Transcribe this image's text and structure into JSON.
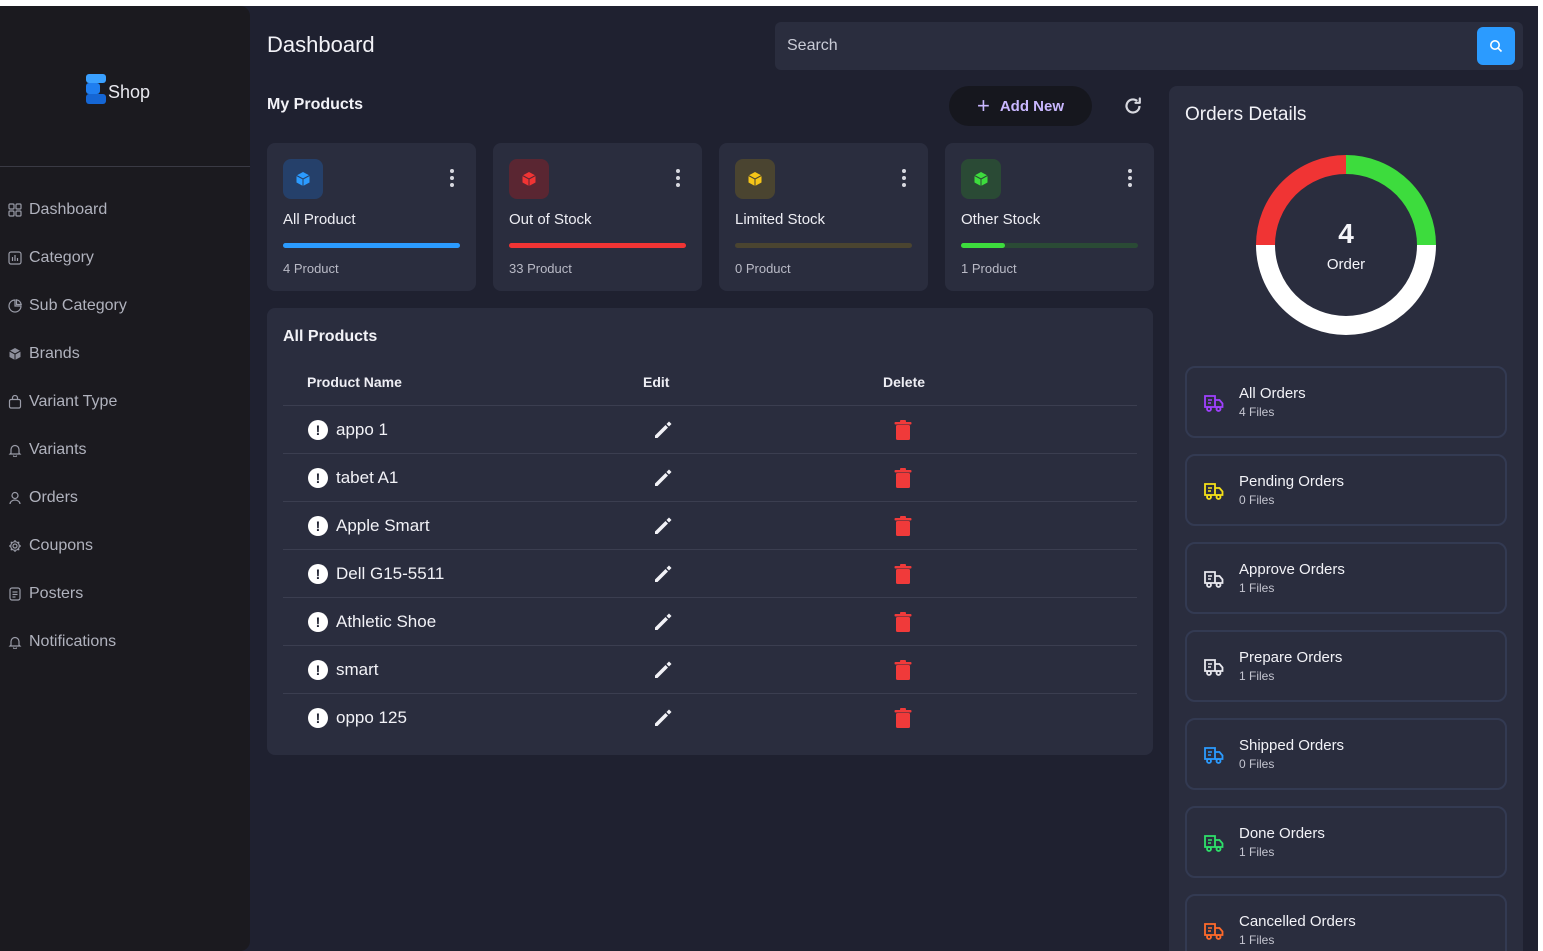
{
  "brand": {
    "name": "Shop"
  },
  "sidebar": {
    "items": [
      {
        "label": "Dashboard",
        "icon": "grid-icon"
      },
      {
        "label": "Category",
        "icon": "chart-icon"
      },
      {
        "label": "Sub Category",
        "icon": "pie-icon"
      },
      {
        "label": "Brands",
        "icon": "cube-icon"
      },
      {
        "label": "Variant Type",
        "icon": "bag-icon"
      },
      {
        "label": "Variants",
        "icon": "bell-icon"
      },
      {
        "label": "Orders",
        "icon": "user-icon"
      },
      {
        "label": "Coupons",
        "icon": "gear-icon"
      },
      {
        "label": "Posters",
        "icon": "document-icon"
      },
      {
        "label": "Notifications",
        "icon": "bell-icon"
      }
    ]
  },
  "header": {
    "title": "Dashboard",
    "search_placeholder": "Search"
  },
  "my_products": {
    "title": "My Products",
    "add_new_label": "Add New",
    "cards": [
      {
        "title": "All Product",
        "subtitle": "4 Product",
        "color": "#2b9bff",
        "icon_bg": "#25406a",
        "track": "#25406a",
        "progress": 1.0
      },
      {
        "title": "Out of Stock",
        "subtitle": "33 Product",
        "color": "#f03434",
        "icon_bg": "#5a2632",
        "track": "#5a2632",
        "progress": 1.0
      },
      {
        "title": "Limited Stock",
        "subtitle": "0 Product",
        "color": "#f5c518",
        "icon_bg": "#4a4430",
        "track": "#4a4430",
        "progress": 0.0
      },
      {
        "title": "Other Stock",
        "subtitle": "1 Product",
        "color": "#3ddc3d",
        "icon_bg": "#2a4a35",
        "track": "#2a4a35",
        "progress": 0.25
      }
    ]
  },
  "all_products": {
    "title": "All Products",
    "columns": [
      "Product Name",
      "Edit",
      "Delete"
    ],
    "rows": [
      {
        "name": "appo 1"
      },
      {
        "name": "tabet A1"
      },
      {
        "name": "Apple Smart"
      },
      {
        "name": "Dell G15-5511"
      },
      {
        "name": "Athletic Shoe"
      },
      {
        "name": "smart"
      },
      {
        "name": "oppo 125"
      }
    ]
  },
  "orders": {
    "title": "Orders Details",
    "total": "4",
    "total_label": "Order",
    "donut": [
      {
        "label": "white",
        "color": "#ffffff",
        "value": 0.5
      },
      {
        "label": "red",
        "color": "#f03434",
        "value": 0.25
      },
      {
        "label": "green",
        "color": "#3ddc3d",
        "value": 0.25
      }
    ],
    "items": [
      {
        "label": "All Orders",
        "sub": "4 Files",
        "color": "#a040ff"
      },
      {
        "label": "Pending Orders",
        "sub": "0 Files",
        "color": "#f5e018"
      },
      {
        "label": "Approve Orders",
        "sub": "1 Files",
        "color": "#e8e8ee"
      },
      {
        "label": "Prepare Orders",
        "sub": "1 Files",
        "color": "#e8e8ee"
      },
      {
        "label": "Shipped Orders",
        "sub": "0 Files",
        "color": "#2b9bff"
      },
      {
        "label": "Done Orders",
        "sub": "1 Files",
        "color": "#2ee06a"
      },
      {
        "label": "Cancelled Orders",
        "sub": "1 Files",
        "color": "#ff6a2a"
      }
    ]
  }
}
